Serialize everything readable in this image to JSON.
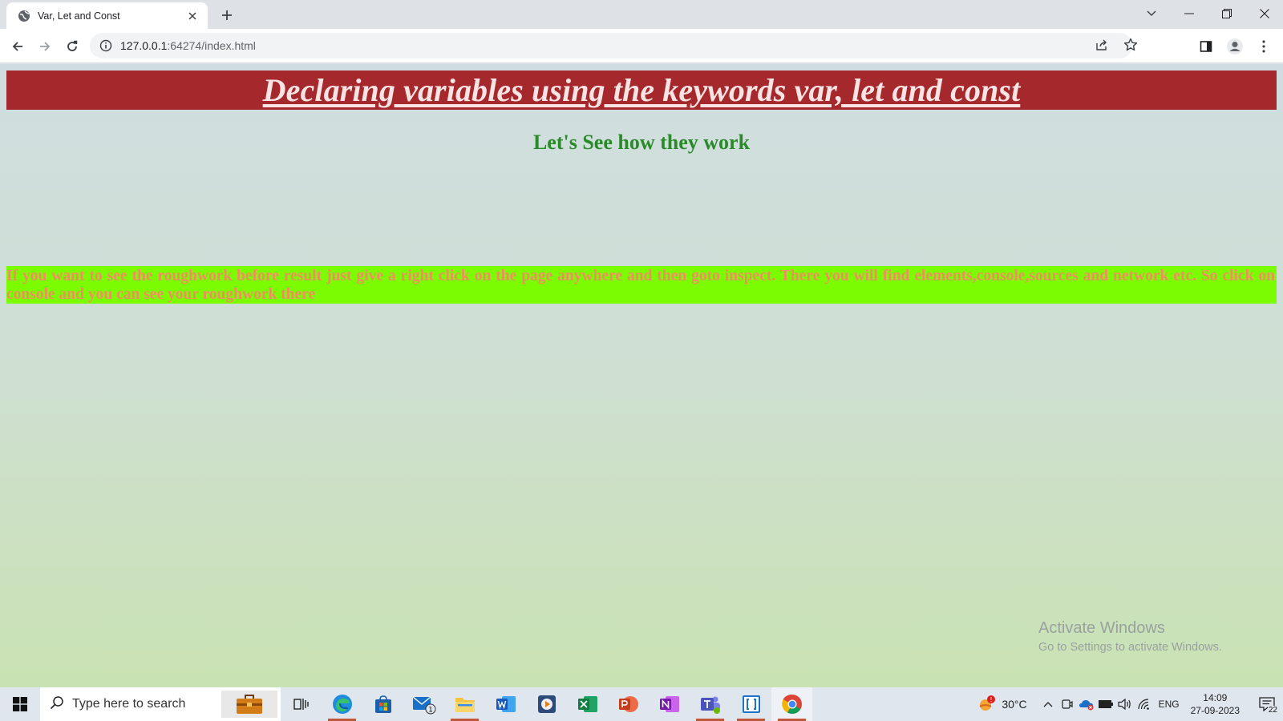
{
  "browser": {
    "tab": {
      "title": "Var, Let and Const",
      "favicon": "globe-icon"
    },
    "address": {
      "host": "127.0.0.1",
      "port_path": ":64274/index.html"
    }
  },
  "page": {
    "heading": "Declaring variables using the keywords var, let and const",
    "subheading": "Let's See how they work",
    "note": "If you want to see the roughwork before result just give a right click on the page anywhere and then goto inspect. There you will find elements,console,sources and network etc. So click on console and you can see your roughwork there",
    "colors": {
      "heading_bg": "#a5282c",
      "heading_text": "#f9e3e3",
      "subheading": "#2a8a2a",
      "note_bg": "#7cfc00",
      "note_text": "#f28c62"
    }
  },
  "watermark": {
    "line1": "Activate Windows",
    "line2": "Go to Settings to activate Windows."
  },
  "taskbar": {
    "search_placeholder": "Type here to search",
    "mail_badge": "1",
    "weather": "30°C",
    "language": "ENG",
    "time": "14:09",
    "date": "27-09-2023",
    "notifications": "22",
    "apps": [
      "task-view",
      "edge",
      "store",
      "mail",
      "file-explorer",
      "word",
      "media",
      "excel",
      "powerpoint",
      "onenote",
      "teams",
      "brackets",
      "chrome"
    ]
  }
}
